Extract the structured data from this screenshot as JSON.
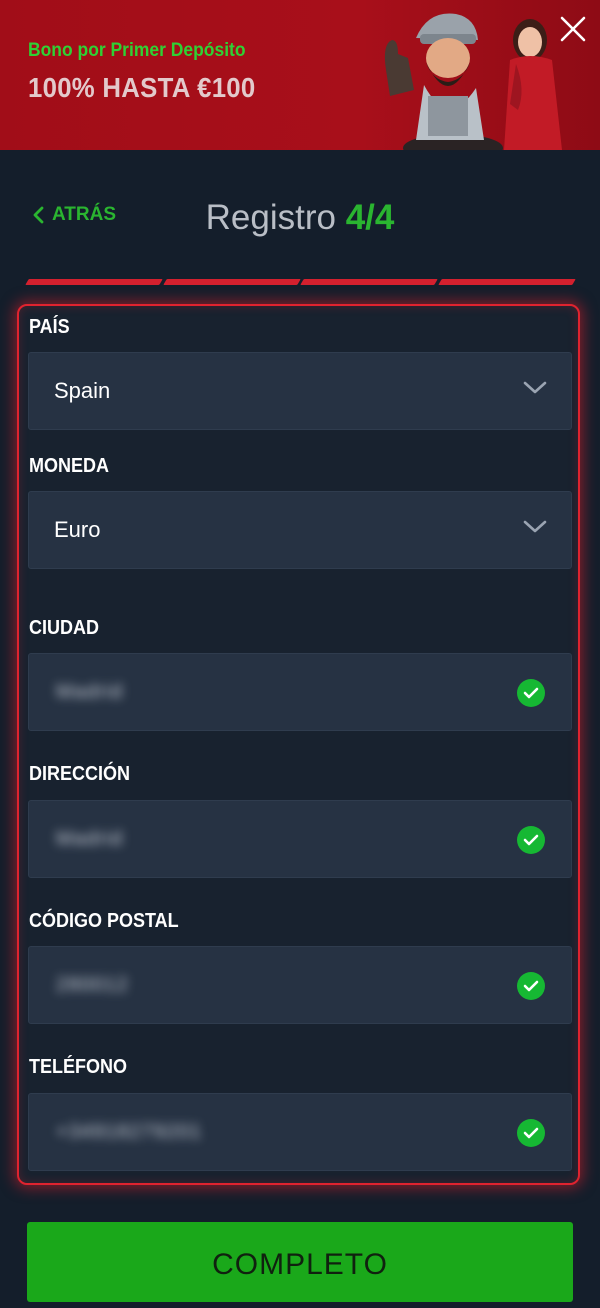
{
  "banner": {
    "title": "Bono por Primer Depósito",
    "offer": "100% HASTA €100"
  },
  "header": {
    "back_label": "ATRÁS",
    "title": "Registro",
    "step": "4/4"
  },
  "progress": {
    "steps_total": 4,
    "steps_completed": 4
  },
  "form": {
    "pais": {
      "label": "PAÍS",
      "value": "Spain"
    },
    "moneda": {
      "label": "MONEDA",
      "value": "Euro"
    },
    "ciudad": {
      "label": "CIUDAD",
      "value": "Madrid"
    },
    "direccion": {
      "label": "DIRECCIÓN",
      "value": "Madrid"
    },
    "codigo_postal": {
      "label": "CÓDIGO POSTAL",
      "value": "280012"
    },
    "telefono": {
      "label": "TELÉFONO",
      "value": "+34918279201"
    }
  },
  "submit_label": "COMPLETO",
  "colors": {
    "accent_green": "#2ab530",
    "banner_red": "#a10d18",
    "panel_border_red": "#e0232f",
    "background": "#141e2b",
    "check_green": "#16b833"
  }
}
